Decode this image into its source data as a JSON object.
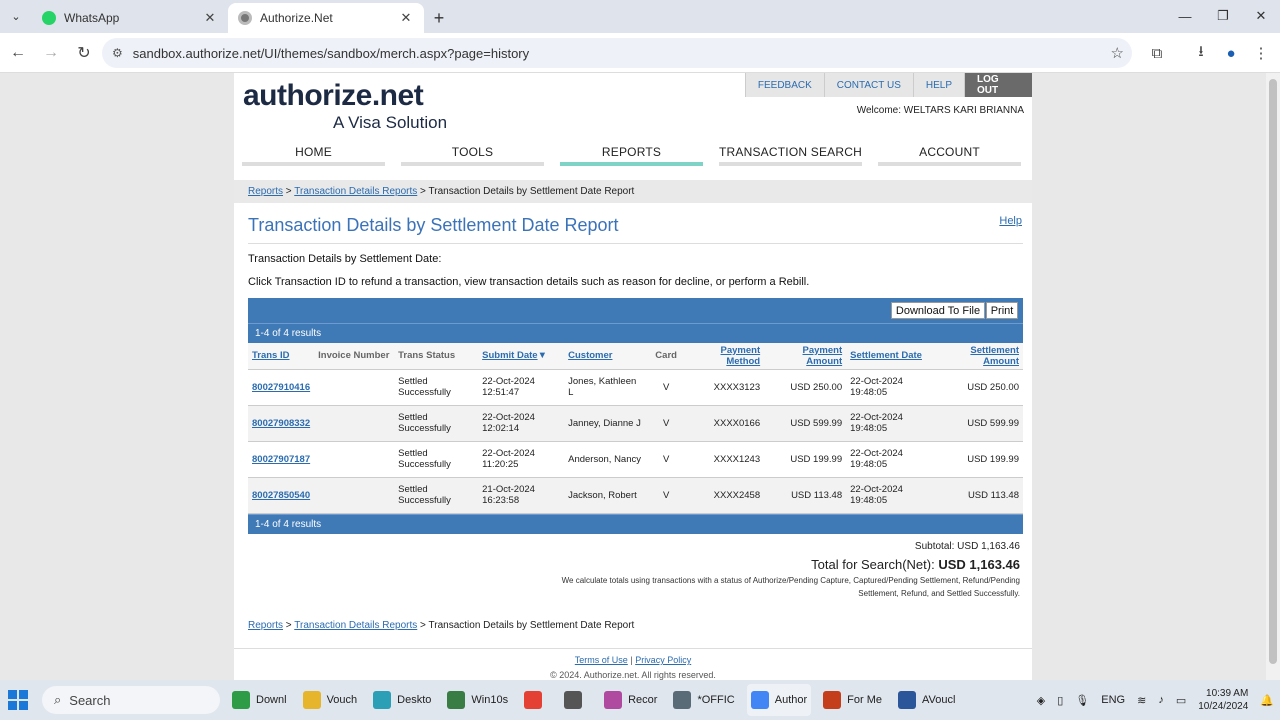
{
  "browser": {
    "tabs": [
      {
        "label": "WhatsApp",
        "icon": "whatsapp-icon",
        "active": false
      },
      {
        "label": "Authorize.Net",
        "icon": "globe-icon",
        "active": true
      }
    ],
    "url": "sandbox.authorize.net/UI/themes/sandbox/merch.aspx?page=history"
  },
  "site": {
    "logo_main": "authorize.net",
    "logo_sub": "A Visa Solution",
    "top_links": [
      "FEEDBACK",
      "CONTACT US",
      "HELP",
      "LOG OUT"
    ],
    "welcome": "Welcome: WELTARS KARI BRIANNA",
    "nav": [
      "HOME",
      "TOOLS",
      "REPORTS",
      "TRANSACTION SEARCH",
      "ACCOUNT"
    ],
    "nav_active": "REPORTS"
  },
  "breadcrumb": {
    "link1": "Reports",
    "sep": ">",
    "link2": "Transaction Details Reports",
    "current": "Transaction Details by Settlement Date Report"
  },
  "report": {
    "title": "Transaction Details by Settlement Date Report",
    "help": "Help",
    "subtitle": "Transaction Details by Settlement Date:",
    "instructions": "Click Transaction ID to refund a transaction, view transaction details such as reason for decline, or perform a Rebill.",
    "download_label": "Download To File",
    "print_label": "Print",
    "results_label": "1-4 of 4 results",
    "columns": [
      "Trans ID",
      "Invoice Number",
      "Trans Status",
      "Submit Date",
      "Customer",
      "Card",
      "Payment Method",
      "Payment Amount",
      "Settlement Date",
      "Settlement Amount"
    ],
    "rows": [
      {
        "trans_id": "80027910416",
        "invoice": "",
        "status": "Settled Successfully",
        "submit_date": "22-Oct-2024 12:51:47",
        "customer": "Jones, Kathleen L",
        "card": "V",
        "method": "XXXX3123",
        "amount": "USD 250.00",
        "settle_date": "22-Oct-2024 19:48:05",
        "settle_amount": "USD 250.00"
      },
      {
        "trans_id": "80027908332",
        "invoice": "",
        "status": "Settled Successfully",
        "submit_date": "22-Oct-2024 12:02:14",
        "customer": "Janney, Dianne J",
        "card": "V",
        "method": "XXXX0166",
        "amount": "USD 599.99",
        "settle_date": "22-Oct-2024 19:48:05",
        "settle_amount": "USD 599.99"
      },
      {
        "trans_id": "80027907187",
        "invoice": "",
        "status": "Settled Successfully",
        "submit_date": "22-Oct-2024 11:20:25",
        "customer": "Anderson, Nancy",
        "card": "V",
        "method": "XXXX1243",
        "amount": "USD 199.99",
        "settle_date": "22-Oct-2024 19:48:05",
        "settle_amount": "USD 199.99"
      },
      {
        "trans_id": "80027850540",
        "invoice": "",
        "status": "Settled Successfully",
        "submit_date": "21-Oct-2024 16:23:58",
        "customer": "Jackson, Robert",
        "card": "V",
        "method": "XXXX2458",
        "amount": "USD 113.48",
        "settle_date": "22-Oct-2024 19:48:05",
        "settle_amount": "USD 113.48"
      }
    ],
    "subtotal": "Subtotal: USD 1,163.46",
    "total_label": "Total for Search(Net):",
    "total_value": "USD 1,163.46",
    "note": "We calculate totals using transactions with a status of Authorize/Pending Capture, Captured/Pending Settlement, Refund/Pending Settlement, Refund, and Settled Successfully."
  },
  "footer": {
    "terms": "Terms of Use",
    "divider": "|",
    "privacy": "Privacy Policy",
    "copyright": "© 2024. Authorize.net. All rights reserved."
  },
  "taskbar": {
    "search": "Search",
    "apps": [
      {
        "label": "Downl",
        "color": "#2e9b47"
      },
      {
        "label": "Vouch",
        "color": "#e7b52b"
      },
      {
        "label": "Deskto",
        "color": "#2a9fb5"
      },
      {
        "label": "Win10s",
        "color": "#3a7d44"
      },
      {
        "label": "",
        "color": "#e44134"
      },
      {
        "label": "",
        "color": "#555555"
      },
      {
        "label": "Recor",
        "color": "#b04aa0"
      },
      {
        "label": "*OFFIC",
        "color": "#5a6b78"
      },
      {
        "label": "Author",
        "color": "#4285f4"
      },
      {
        "label": "For Me",
        "color": "#c43e1c"
      },
      {
        "label": "AVoucl",
        "color": "#2b579a"
      }
    ],
    "lang": "ENG",
    "time": "10:39 AM",
    "date": "10/24/2024"
  }
}
